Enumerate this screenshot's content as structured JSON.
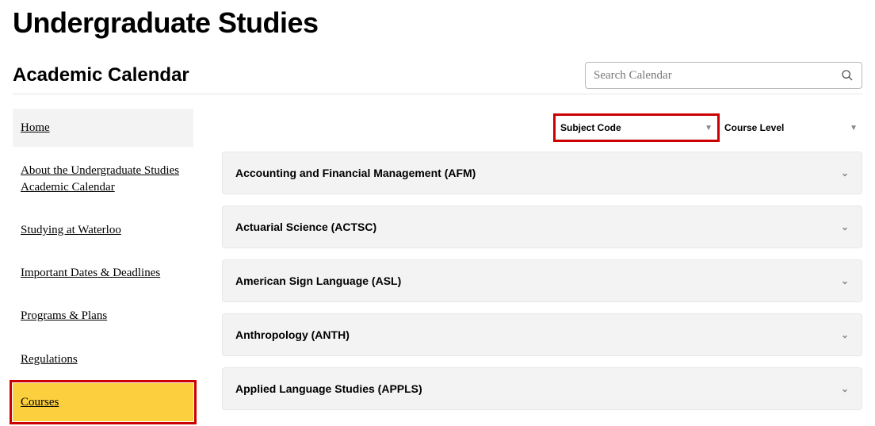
{
  "header": {
    "page_title": "Undergraduate Studies",
    "subhead": "Academic Calendar"
  },
  "search": {
    "placeholder": "Search Calendar",
    "value": ""
  },
  "sidebar": {
    "items": [
      {
        "label": "Home",
        "active": false,
        "home": true
      },
      {
        "label": "About the Undergraduate Studies Academic Calendar"
      },
      {
        "label": "Studying at Waterloo"
      },
      {
        "label": "Important Dates & Deadlines"
      },
      {
        "label": "Programs & Plans"
      },
      {
        "label": "Regulations"
      },
      {
        "label": "Courses",
        "active": true,
        "highlight": true
      }
    ]
  },
  "filters": {
    "subject_code": {
      "label": "Subject Code"
    },
    "course_level": {
      "label": "Course Level"
    }
  },
  "accordion": [
    {
      "label": "Accounting and Financial Management (AFM)"
    },
    {
      "label": "Actuarial Science (ACTSC)"
    },
    {
      "label": "American Sign Language (ASL)"
    },
    {
      "label": "Anthropology (ANTH)"
    },
    {
      "label": "Applied Language Studies (APPLS)"
    }
  ]
}
